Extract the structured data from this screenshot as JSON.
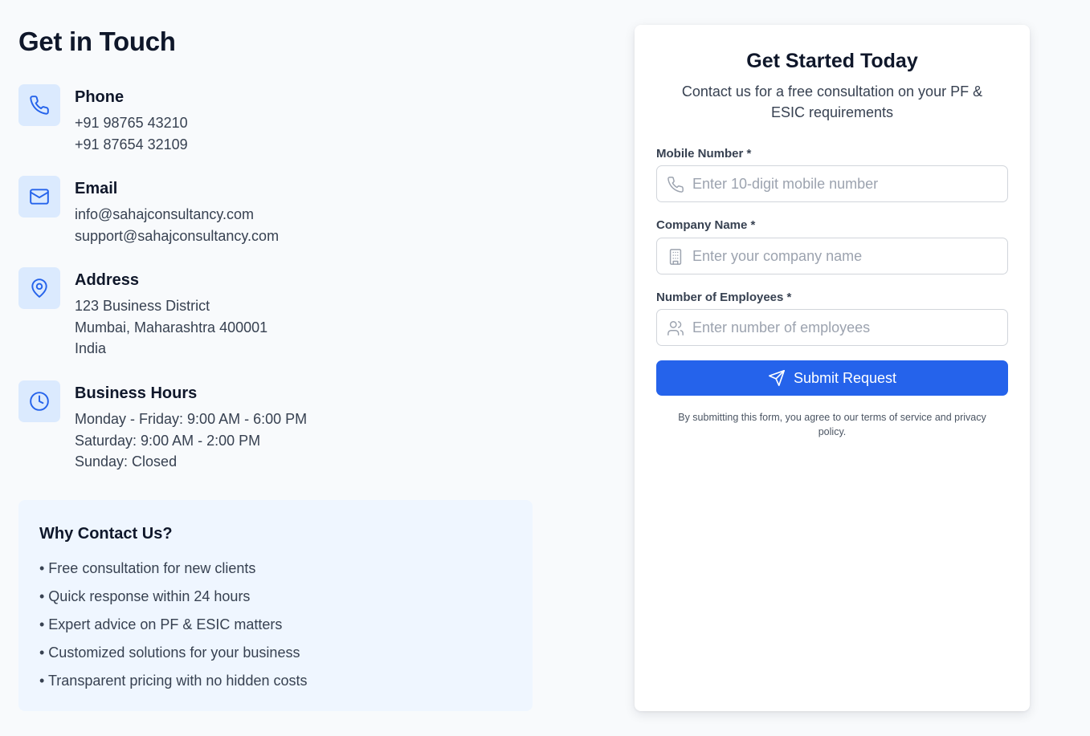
{
  "contact": {
    "title": "Get in Touch",
    "phone": {
      "label": "Phone",
      "lines": [
        "+91 98765 43210",
        "+91 87654 32109"
      ],
      "icon": "phone-icon"
    },
    "email": {
      "label": "Email",
      "lines": [
        "info@sahajconsultancy.com",
        "support@sahajconsultancy.com"
      ],
      "icon": "mail-icon"
    },
    "address": {
      "label": "Address",
      "lines": [
        "123 Business District",
        "Mumbai, Maharashtra 400001",
        "India"
      ],
      "icon": "map-pin-icon"
    },
    "hours": {
      "label": "Business Hours",
      "lines": [
        "Monday - Friday: 9:00 AM - 6:00 PM",
        "Saturday: 9:00 AM - 2:00 PM",
        "Sunday: Closed"
      ],
      "icon": "clock-icon"
    }
  },
  "why": {
    "title": "Why Contact Us?",
    "items": [
      "• Free consultation for new clients",
      "• Quick response within 24 hours",
      "• Expert advice on PF & ESIC matters",
      "• Customized solutions for your business",
      "• Transparent pricing with no hidden costs"
    ]
  },
  "form": {
    "title": "Get Started Today",
    "subtitle": "Contact us for a free consultation on your PF & ESIC requirements",
    "mobile": {
      "label": "Mobile Number *",
      "placeholder": "Enter 10-digit mobile number",
      "value": ""
    },
    "company": {
      "label": "Company Name *",
      "placeholder": "Enter your company name",
      "value": ""
    },
    "employees": {
      "label": "Number of Employees *",
      "placeholder": "Enter number of employees",
      "value": ""
    },
    "submit_label": "Submit Request",
    "disclaimer": "By submitting this form, you agree to our terms of service and privacy policy."
  },
  "colors": {
    "accent": "#2563eb",
    "icon_bg": "#dbeafe",
    "panel_bg": "#eff6ff",
    "page_bg": "#f8fafc"
  }
}
